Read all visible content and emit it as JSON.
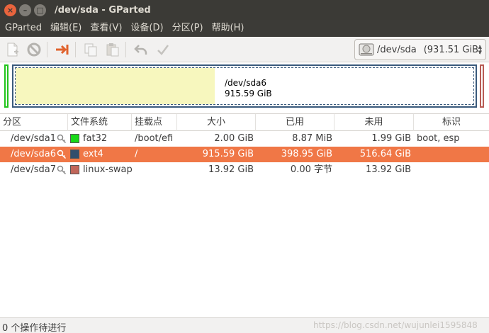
{
  "window": {
    "title": "/dev/sda - GParted",
    "close_glyph": "×",
    "minimize_glyph": "–",
    "maximize_glyph": "□"
  },
  "menu": [
    "GParted",
    "编辑(E)",
    "查看(V)",
    "设备(D)",
    "分区(P)",
    "帮助(H)"
  ],
  "toolbar": {
    "icons": [
      "new-partition-icon",
      "delete-icon",
      "resize-move-icon",
      "copy-icon",
      "paste-icon",
      "undo-icon",
      "apply-icon"
    ],
    "device": "/dev/sda",
    "device_size": "(931.51 GiB)"
  },
  "disk_map": {
    "selected_partition": "/dev/sda6",
    "selected_size": "915.59 GiB",
    "used_fraction": 0.4357
  },
  "table": {
    "headers": [
      "分区",
      "文件系统",
      "挂载点",
      "大小",
      "已用",
      "未用",
      "标识"
    ],
    "rows": [
      {
        "partition": "/dev/sda1",
        "filesystem": "fat32",
        "fs_color": "#18d918",
        "mount": "/boot/efi",
        "size": "2.00 GiB",
        "used": "8.87 MiB",
        "unused": "1.99 GiB",
        "flags": "boot, esp",
        "selected": false
      },
      {
        "partition": "/dev/sda6",
        "filesystem": "ext4",
        "fs_color": "#314e6c",
        "mount": "/",
        "size": "915.59 GiB",
        "used": "398.95 GiB",
        "unused": "516.64 GiB",
        "flags": "",
        "selected": true
      },
      {
        "partition": "/dev/sda7",
        "filesystem": "linux-swap",
        "fs_color": "#c1665a",
        "mount": "",
        "size": "13.92 GiB",
        "used": "0.00 字节",
        "unused": "13.92 GiB",
        "flags": "",
        "selected": false
      }
    ]
  },
  "status": {
    "text": "0 个操作待进行",
    "watermark": "https://blog.csdn.net/wujunlei1595848"
  },
  "colors": {
    "selection": "#f07746",
    "titlebar": "#3b3a36",
    "used_space": "#f7f7be",
    "ext4_border": "#3a5a7c",
    "fat32_border": "#21c41b",
    "swap_border": "#b85c55"
  }
}
